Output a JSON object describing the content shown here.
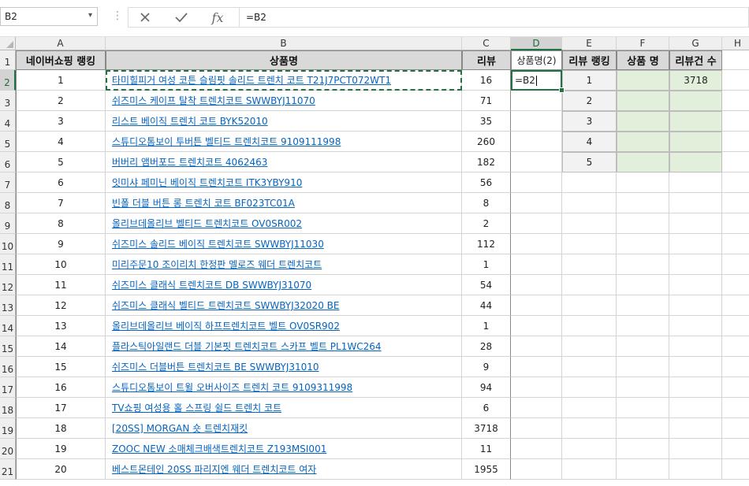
{
  "formula_bar": {
    "name_box": "B2",
    "cancel_icon": "x-icon",
    "enter_icon": "check-icon",
    "fx_label": "fx",
    "formula": "=B2"
  },
  "columns": [
    "A",
    "B",
    "C",
    "D",
    "E",
    "F",
    "G",
    "H"
  ],
  "header_row": {
    "a": "네이버쇼핑 랭킹",
    "b": "상품명",
    "c": "리뷰",
    "d": "상품명(2)",
    "e": "리뷰 랭킹",
    "f": "상품 명",
    "g": "리뷰건 수"
  },
  "rows": [
    {
      "num": "1",
      "rank": "1",
      "name": "타미힐피거 여성 코튼 슬림핏 솔리드 트렌치 코트 T21J7PCT072WT1",
      "reviews": "16"
    },
    {
      "num": "2",
      "rank": "2",
      "name": "쉬즈미스 케이프 탈착 트렌치코트 SWWBYJ11070",
      "reviews": "71"
    },
    {
      "num": "3",
      "rank": "3",
      "name": "리스트 베이직 트렌치 코트 BYK52010",
      "reviews": "35"
    },
    {
      "num": "4",
      "rank": "4",
      "name": "스튜디오톰보이 투버튼 벨티드 트렌치코트 9109111998",
      "reviews": "260"
    },
    {
      "num": "5",
      "rank": "5",
      "name": "버버리 앰버포드 트렌치코트 4062463",
      "reviews": "182"
    },
    {
      "num": "6",
      "rank": "6",
      "name": "잇미샤 페미닌 베이직 트렌치코트 ITK3YBY910",
      "reviews": "56"
    },
    {
      "num": "7",
      "rank": "7",
      "name": "빈폴 더블 버튼 롱 트렌치 코트 BF023TC01A",
      "reviews": "8"
    },
    {
      "num": "8",
      "rank": "8",
      "name": "올리브데올리브 벨티드 트렌치코트 OV0SR002",
      "reviews": "2"
    },
    {
      "num": "9",
      "rank": "9",
      "name": "쉬즈미스 솔리드 베이직 트렌치코트 SWWBYJ11030",
      "reviews": "112"
    },
    {
      "num": "10",
      "rank": "10",
      "name": "미리주문10 조이리치 한정판 멜로즈 웨더 트렌치코트",
      "reviews": "1"
    },
    {
      "num": "11",
      "rank": "11",
      "name": "쉬즈미스 클래식 트렌치코트 DB SWWBYJ31070",
      "reviews": "54"
    },
    {
      "num": "12",
      "rank": "12",
      "name": "쉬즈미스 클래식 벨티드 트렌치코트 SWWBYJ32020 BE",
      "reviews": "44"
    },
    {
      "num": "13",
      "rank": "13",
      "name": "올리브데올리브 베이직 하프트렌치코트 벨트 OV0SR902",
      "reviews": "1"
    },
    {
      "num": "14",
      "rank": "14",
      "name": "플라스틱아일랜드 더블 기본핏 트렌치코트 스카프 벨트 PL1WC264",
      "reviews": "28"
    },
    {
      "num": "15",
      "rank": "15",
      "name": "쉬즈미스 더블버튼 트렌치코트 BE SWWBYJ31010",
      "reviews": "9"
    },
    {
      "num": "16",
      "rank": "16",
      "name": "스튜디오톰보이 트윌 오버사이즈 트렌치 코트 9109311998",
      "reviews": "94"
    },
    {
      "num": "17",
      "rank": "17",
      "name": "TV쇼핑 여성용 홀 스프링 쉴드 트렌치 코트",
      "reviews": "6"
    },
    {
      "num": "18",
      "rank": "18",
      "name": "[20SS] MORGAN 숏 트렌치재킷",
      "reviews": "3718"
    },
    {
      "num": "19",
      "rank": "19",
      "name": "ZOOC NEW 소매체크배색트렌치코트 Z193MSI001",
      "reviews": "11"
    },
    {
      "num": "20",
      "rank": "20",
      "name": "베스트몬테인 20SS 파리지엔 웨더 트렌치코트 여자",
      "reviews": "1955"
    }
  ],
  "active_cell": {
    "ref": "D2",
    "text": "=B2"
  },
  "review_ranking": [
    {
      "rank": "1",
      "product": "",
      "count": "3718"
    },
    {
      "rank": "2",
      "product": "",
      "count": ""
    },
    {
      "rank": "3",
      "product": "",
      "count": ""
    },
    {
      "rank": "4",
      "product": "",
      "count": ""
    },
    {
      "rank": "5",
      "product": "",
      "count": ""
    }
  ],
  "colors": {
    "header_fill": "#d9d9d9",
    "green_fill": "#e2efda",
    "link": "#0563c1",
    "selection": "#217346"
  }
}
